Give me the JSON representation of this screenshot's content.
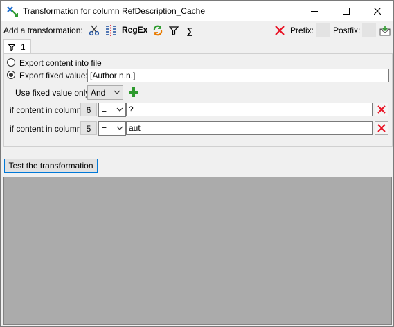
{
  "window": {
    "title": "Transformation for column RefDescription_Cache",
    "controls": [
      "minimize-icon",
      "maximize-icon",
      "close-icon"
    ]
  },
  "toolbar": {
    "add_label": "Add a transformation:",
    "tools": [
      "scissors-icon",
      "split-columns-icon",
      "RegEx",
      "replace-icon",
      "filter-icon",
      "sum-icon"
    ],
    "regex_label": "RegEx",
    "sum_symbol": "∑",
    "prefix_label": "Prefix:",
    "postfix_label": "Postfix:",
    "delete_icon": "red-x-icon",
    "mail_icon": "envelope-icon"
  },
  "tab": {
    "label": "1",
    "icon": "filter-icon"
  },
  "panel": {
    "export_content_label": "Export content into file",
    "export_fixed_label": "Export fixed value:",
    "fixed_value": "[Author n.n.]",
    "export_mode_selected": "export_fixed",
    "use_fixed_label": "Use fixed value only",
    "conjunction": "And",
    "add_icon": "plus-icon",
    "conditions": [
      {
        "label": "if content in column",
        "column": "6",
        "operator": "=",
        "value": "?"
      },
      {
        "label": "if content in column",
        "column": "5",
        "operator": "=",
        "value": "aut"
      }
    ]
  },
  "test_button_label": "Test the transformation",
  "colors": {
    "accent": "#0078d7",
    "output_bg": "#ababab",
    "delete_red": "#e81123",
    "add_green": "#2e9a2e"
  }
}
